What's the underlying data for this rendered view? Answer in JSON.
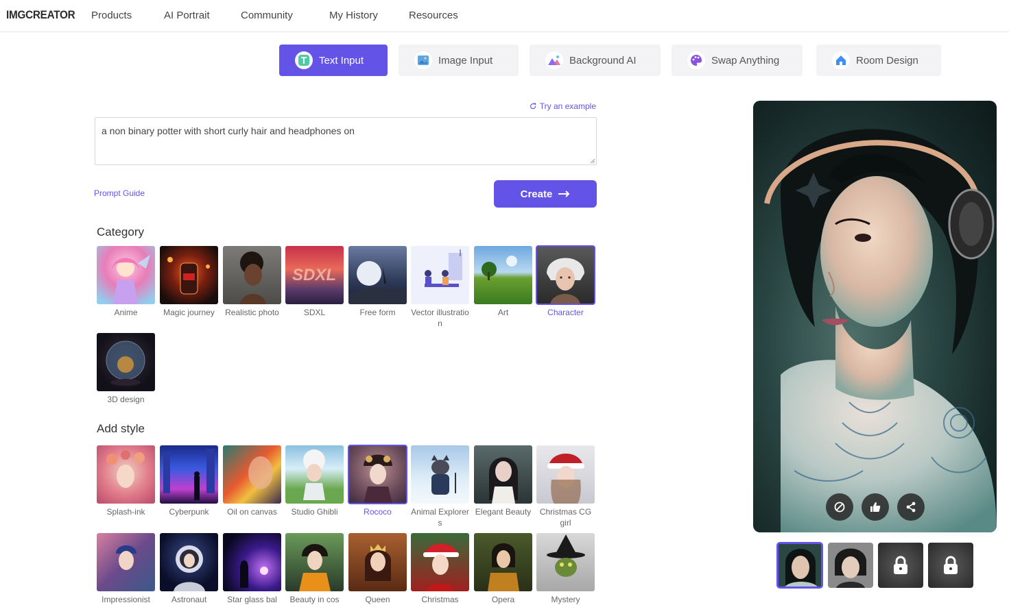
{
  "brand": "IMGCREATOR",
  "nav": [
    "Products",
    "AI Portrait",
    "Community",
    "My History",
    "Resources"
  ],
  "tabs": [
    {
      "label": "Text Input",
      "icon": "text-icon",
      "active": true
    },
    {
      "label": "Image Input",
      "icon": "image-icon"
    },
    {
      "label": "Background AI",
      "icon": "mountain-icon"
    },
    {
      "label": "Swap Anything",
      "icon": "palette-icon"
    },
    {
      "label": "Room Design",
      "icon": "house-icon"
    }
  ],
  "prompt": {
    "try_example": "Try an example",
    "text": "a non binary potter with short curly hair and headphones on",
    "guide": "Prompt Guide",
    "create": "Create"
  },
  "category": {
    "title": "Category",
    "items": [
      "Anime",
      "Magic journey",
      "Realistic photo",
      "SDXL",
      "Free form",
      "Vector illustration",
      "Art",
      "Character",
      "3D design"
    ],
    "selected": "Character"
  },
  "style": {
    "title": "Add style",
    "items": [
      "Splash-ink",
      "Cyberpunk",
      "Oil on canvas",
      "Studio Ghibli",
      "Rococo",
      "Animal Explorers",
      "Elegant Beauty",
      "Christmas CG girl",
      "Impressionist",
      "Astronaut",
      "Star glass bal",
      "Beauty in cos",
      "Queen",
      "Christmas",
      "Opera",
      "Mystery"
    ],
    "selected": "Rococo"
  },
  "colors": {
    "accent": "#6353e6"
  }
}
